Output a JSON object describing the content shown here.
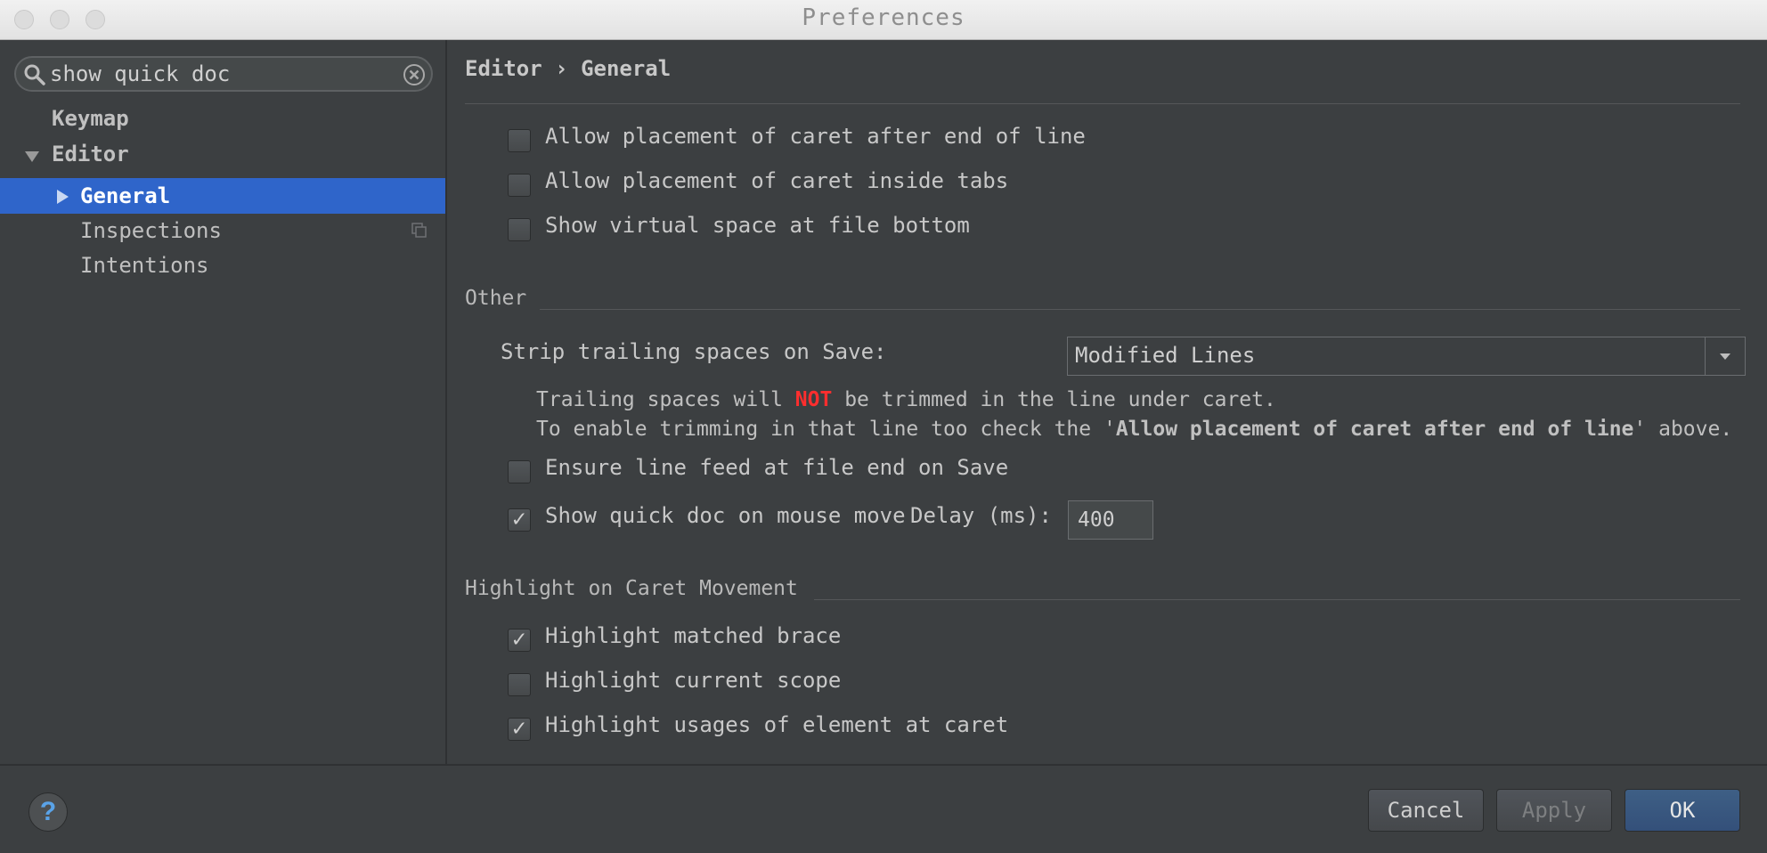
{
  "window": {
    "title": "Preferences"
  },
  "search": {
    "value": "show quick doc"
  },
  "sidebar": {
    "items": [
      {
        "label": "Keymap"
      },
      {
        "label": "Editor"
      },
      {
        "label": "General"
      },
      {
        "label": "Inspections"
      },
      {
        "label": "Intentions"
      }
    ]
  },
  "main": {
    "breadcrumb": {
      "part1": "Editor",
      "sep": "›",
      "part2": "General"
    },
    "virtual_space": {
      "options": [
        {
          "label": "Allow placement of caret after end of line",
          "checked": false
        },
        {
          "label": "Allow placement of caret inside tabs",
          "checked": false
        },
        {
          "label": "Show virtual space at file bottom",
          "checked": false
        }
      ]
    },
    "other": {
      "title": "Other",
      "strip_label": "Strip trailing spaces on Save:",
      "strip_value": "Modified Lines",
      "hint_line1_pre": "Trailing spaces will ",
      "hint_line1_not": "NOT",
      "hint_line1_post": " be trimmed in the line under caret.",
      "hint_line2_pre": "To enable trimming in that line too check the '",
      "hint_line2_bold": "Allow placement of caret after end of line",
      "hint_line2_post": "' above.",
      "ensure_line_feed": {
        "label": "Ensure line feed at file end on Save",
        "checked": false
      },
      "quick_doc": {
        "label": "Show quick doc on mouse move",
        "checked": true
      },
      "delay_label": "Delay (ms):",
      "delay_value": "400"
    },
    "highlight": {
      "title": "Highlight on Caret Movement",
      "options": [
        {
          "label": "Highlight matched brace",
          "checked": true
        },
        {
          "label": "Highlight current scope",
          "checked": false
        },
        {
          "label": "Highlight usages of element at caret",
          "checked": true
        }
      ]
    }
  },
  "footer": {
    "help": "?",
    "cancel": "Cancel",
    "apply": "Apply",
    "ok": "OK"
  },
  "colors": {
    "selection": "#2f65ca",
    "not_highlight": "#ff2e2e",
    "help_icon": "#5aa3e8"
  }
}
